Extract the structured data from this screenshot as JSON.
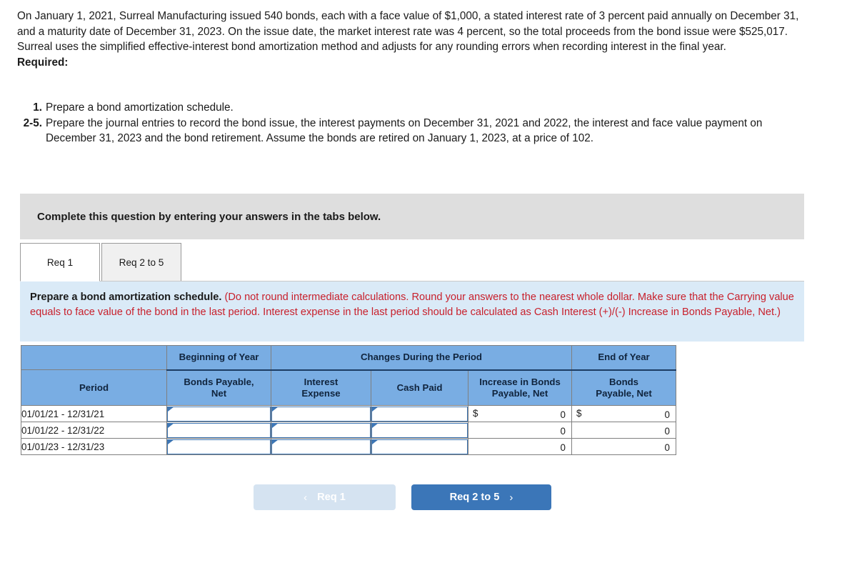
{
  "problem": {
    "paragraph": "On January 1, 2021, Surreal Manufacturing issued 540 bonds, each with a face value of $1,000, a stated interest rate of 3 percent paid annually on December 31, and a maturity date of December 31, 2023. On the issue date, the market interest rate was 4 percent, so the total proceeds from the bond issue were $525,017. Surreal uses the simplified effective-interest bond amortization method and adjusts for any rounding errors when recording interest in the final year.",
    "required_label": "Required:",
    "requirements": [
      {
        "number": "1.",
        "text": "Prepare a bond amortization schedule."
      },
      {
        "number": "2-5.",
        "text": "Prepare the journal entries to record the bond issue, the interest payments on December 31, 2021 and 2022, the interest and face value payment on December 31, 2023 and the bond retirement. Assume the bonds are retired on January 1, 2023, at a price of 102."
      }
    ]
  },
  "instruction_banner": {
    "text": "Complete this question by entering your answers in the tabs below."
  },
  "tabs": [
    {
      "label": "Req 1",
      "active": true
    },
    {
      "label": "Req 2 to 5",
      "active": false
    }
  ],
  "info_banner": {
    "lead": "Prepare a bond amortization schedule.",
    "note": "(Do not round intermediate calculations. Round your answers to the nearest whole dollar. Make sure that the Carrying value equals to face value of the bond in the last period. Interest expense in the last period should be calculated as Cash Interest (+)/(-) Increase in Bonds Payable, Net.)"
  },
  "table": {
    "group_headers": [
      {
        "label": "",
        "span": 1,
        "bordered": false
      },
      {
        "label": "Beginning of Year",
        "span": 1,
        "bordered": true
      },
      {
        "label": "Changes During the Period",
        "span": 3,
        "bordered": true
      },
      {
        "label": "End of Year",
        "span": 1,
        "bordered": true
      }
    ],
    "sub_headers": [
      "Period",
      "Bonds Payable,\nNet",
      "Interest\nExpense",
      "Cash Paid",
      "Increase in Bonds\nPayable, Net",
      "Bonds\nPayable, Net"
    ],
    "rows": [
      {
        "period": "01/01/21 - 12/31/21",
        "bonds_payable_beg": "",
        "interest_expense": "",
        "cash_paid": "",
        "increase_currency": "$",
        "increase_value": "0",
        "end_currency": "$",
        "end_value": "0"
      },
      {
        "period": "01/01/22 - 12/31/22",
        "bonds_payable_beg": "",
        "interest_expense": "",
        "cash_paid": "",
        "increase_currency": "",
        "increase_value": "0",
        "end_currency": "",
        "end_value": "0"
      },
      {
        "period": "01/01/23 - 12/31/23",
        "bonds_payable_beg": "",
        "interest_expense": "",
        "cash_paid": "",
        "increase_currency": "",
        "increase_value": "0",
        "end_currency": "",
        "end_value": "0"
      }
    ]
  },
  "nav": {
    "prev_label": "Req 1",
    "prev_chevron": "‹",
    "next_label": "Req 2 to 5",
    "next_chevron": "›"
  },
  "colors": {
    "table_header_blue": "#79ade3",
    "info_banner_blue": "#daeaf7",
    "gray_banner": "#dedede",
    "primary_button": "#3b76b8",
    "disabled_button": "#d5e3f1",
    "note_red": "#c8202c",
    "input_border_blue": "#3f77b5"
  }
}
